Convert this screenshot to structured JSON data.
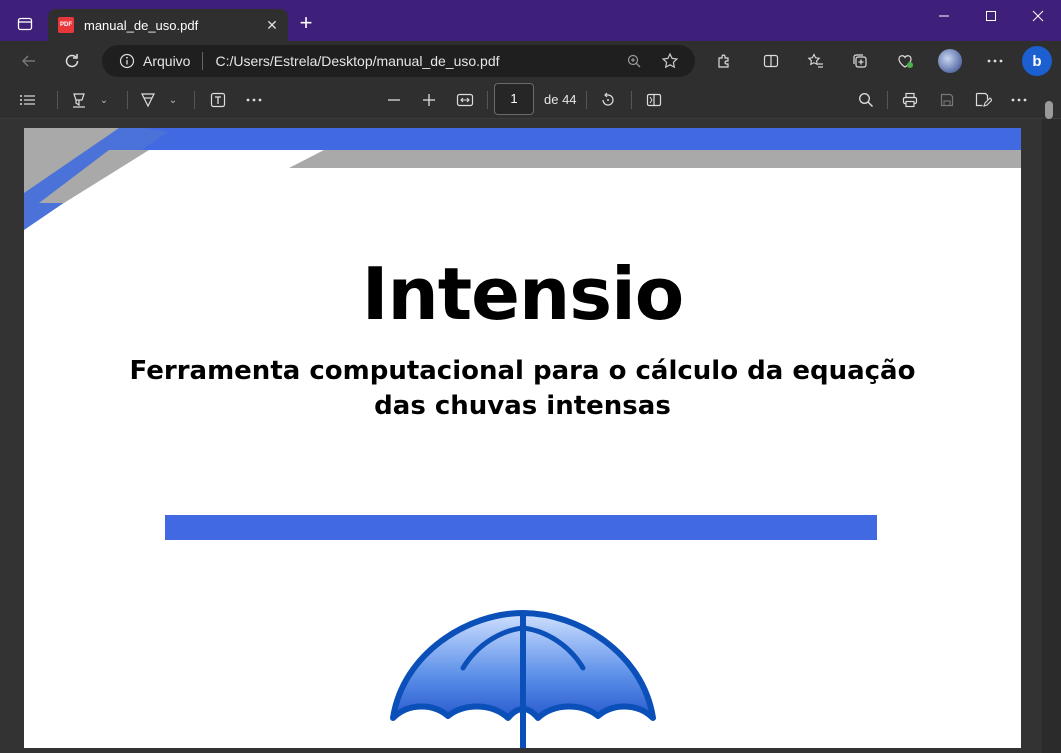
{
  "browser": {
    "tab_title": "manual_de_uso.pdf",
    "tab_badge": "PDF",
    "scheme_label": "Arquivo",
    "url": "C:/Users/Estrela/Desktop/manual_de_uso.pdf",
    "accent_color": "#3e1f7a"
  },
  "pdf_toolbar": {
    "current_page": "1",
    "page_total": "de 44"
  },
  "document": {
    "title": "Intensio",
    "subtitle_line1": "Ferramenta computacional para o cálculo da equação",
    "subtitle_line2": "das chuvas intensas",
    "accent_color": "#4169e1"
  }
}
